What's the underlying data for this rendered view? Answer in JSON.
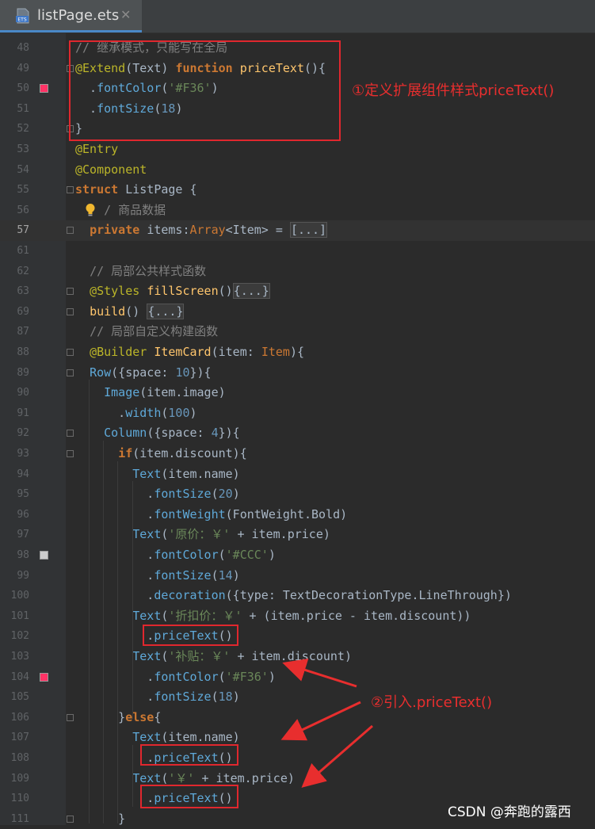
{
  "tab": {
    "title": "listPage.ets",
    "icon": "ets-file-icon",
    "close_glyph": "✕"
  },
  "lines": [
    {
      "n": "48",
      "tokens": [
        [
          "cmt",
          "// 继承模式，只能写在全局"
        ]
      ]
    },
    {
      "n": "49",
      "tokens": [
        [
          "dec",
          "@Extend"
        ],
        [
          "plain",
          "(Text) "
        ],
        [
          "kw",
          "function "
        ],
        [
          "fn",
          "priceText"
        ],
        [
          "plain",
          "(){"
        ]
      ]
    },
    {
      "n": "50",
      "swatch": "#F36",
      "tokens": [
        [
          "plain",
          "  ."
        ],
        [
          "meth",
          "fontColor"
        ],
        [
          "plain",
          "("
        ],
        [
          "str",
          "'#F36'"
        ],
        [
          "plain",
          ")"
        ]
      ]
    },
    {
      "n": "51",
      "tokens": [
        [
          "plain",
          "  ."
        ],
        [
          "meth",
          "fontSize"
        ],
        [
          "plain",
          "("
        ],
        [
          "num",
          "18"
        ],
        [
          "plain",
          ")"
        ]
      ]
    },
    {
      "n": "52",
      "tokens": [
        [
          "plain",
          "}"
        ]
      ]
    },
    {
      "n": "53",
      "tokens": [
        [
          "dec",
          "@Entry"
        ]
      ]
    },
    {
      "n": "54",
      "tokens": [
        [
          "dec",
          "@Component"
        ]
      ]
    },
    {
      "n": "55",
      "tokens": [
        [
          "kw",
          "struct "
        ],
        [
          "plain",
          "ListPage {"
        ]
      ]
    },
    {
      "n": "56",
      "tokens": [
        [
          "plain",
          "  "
        ],
        [
          "cmt",
          "  / 商品数据"
        ]
      ]
    },
    {
      "n": "57",
      "current": true,
      "tokens": [
        [
          "plain",
          "  "
        ],
        [
          "kw",
          "private "
        ],
        [
          "plain",
          "items:"
        ],
        [
          "ty",
          "Array"
        ],
        [
          "plain",
          "<Item> = "
        ],
        [
          "box",
          "[...]"
        ]
      ]
    },
    {
      "n": "61",
      "tokens": []
    },
    {
      "n": "62",
      "tokens": [
        [
          "plain",
          "  "
        ],
        [
          "cmt",
          "// 局部公共样式函数"
        ]
      ]
    },
    {
      "n": "63",
      "tokens": [
        [
          "plain",
          "  "
        ],
        [
          "dec",
          "@Styles "
        ],
        [
          "fn",
          "fillScreen"
        ],
        [
          "plain",
          "()"
        ],
        [
          "box",
          "{...}"
        ]
      ]
    },
    {
      "n": "69",
      "tokens": [
        [
          "plain",
          "  "
        ],
        [
          "fn",
          "build"
        ],
        [
          "plain",
          "() "
        ],
        [
          "box",
          "{...}"
        ]
      ]
    },
    {
      "n": "87",
      "tokens": [
        [
          "plain",
          "  "
        ],
        [
          "cmt",
          "// 局部自定义构建函数"
        ]
      ]
    },
    {
      "n": "88",
      "tokens": [
        [
          "plain",
          "  "
        ],
        [
          "dec",
          "@Builder "
        ],
        [
          "fn",
          "ItemCard"
        ],
        [
          "plain",
          "(item: "
        ],
        [
          "ty",
          "Item"
        ],
        [
          "plain",
          "){"
        ]
      ]
    },
    {
      "n": "89",
      "tokens": [
        [
          "plain",
          "  "
        ],
        [
          "comp",
          "Row"
        ],
        [
          "plain",
          "({space: "
        ],
        [
          "num",
          "10"
        ],
        [
          "plain",
          "}){"
        ]
      ]
    },
    {
      "n": "90",
      "tokens": [
        [
          "plain",
          "    "
        ],
        [
          "comp",
          "Image"
        ],
        [
          "plain",
          "(item.image)"
        ]
      ]
    },
    {
      "n": "91",
      "tokens": [
        [
          "plain",
          "      ."
        ],
        [
          "meth",
          "width"
        ],
        [
          "plain",
          "("
        ],
        [
          "num",
          "100"
        ],
        [
          "plain",
          ")"
        ]
      ]
    },
    {
      "n": "92",
      "tokens": [
        [
          "plain",
          "    "
        ],
        [
          "comp",
          "Column"
        ],
        [
          "plain",
          "({space: "
        ],
        [
          "num",
          "4"
        ],
        [
          "plain",
          "}){"
        ]
      ]
    },
    {
      "n": "93",
      "tokens": [
        [
          "plain",
          "      "
        ],
        [
          "kw",
          "if"
        ],
        [
          "plain",
          "(item.discount){"
        ]
      ]
    },
    {
      "n": "94",
      "tokens": [
        [
          "plain",
          "        "
        ],
        [
          "comp",
          "Text"
        ],
        [
          "plain",
          "(item.name)"
        ]
      ]
    },
    {
      "n": "95",
      "tokens": [
        [
          "plain",
          "          ."
        ],
        [
          "meth",
          "fontSize"
        ],
        [
          "plain",
          "("
        ],
        [
          "num",
          "20"
        ],
        [
          "plain",
          ")"
        ]
      ]
    },
    {
      "n": "96",
      "tokens": [
        [
          "plain",
          "          ."
        ],
        [
          "meth",
          "fontWeight"
        ],
        [
          "plain",
          "(FontWeight.Bold)"
        ]
      ]
    },
    {
      "n": "97",
      "tokens": [
        [
          "plain",
          "        "
        ],
        [
          "comp",
          "Text"
        ],
        [
          "plain",
          "("
        ],
        [
          "str",
          "'原价：￥'"
        ],
        [
          "plain",
          " + item.price)"
        ]
      ]
    },
    {
      "n": "98",
      "swatch": "#CCC",
      "tokens": [
        [
          "plain",
          "          ."
        ],
        [
          "meth",
          "fontColor"
        ],
        [
          "plain",
          "("
        ],
        [
          "str",
          "'#CCC'"
        ],
        [
          "plain",
          ")"
        ]
      ]
    },
    {
      "n": "99",
      "tokens": [
        [
          "plain",
          "          ."
        ],
        [
          "meth",
          "fontSize"
        ],
        [
          "plain",
          "("
        ],
        [
          "num",
          "14"
        ],
        [
          "plain",
          ")"
        ]
      ]
    },
    {
      "n": "100",
      "tokens": [
        [
          "plain",
          "          ."
        ],
        [
          "meth",
          "decoration"
        ],
        [
          "plain",
          "({type: TextDecorationType.LineThrough})"
        ]
      ]
    },
    {
      "n": "101",
      "tokens": [
        [
          "plain",
          "        "
        ],
        [
          "comp",
          "Text"
        ],
        [
          "plain",
          "("
        ],
        [
          "str",
          "'折扣价：￥'"
        ],
        [
          "plain",
          " + (item.price - item.discount))"
        ]
      ]
    },
    {
      "n": "102",
      "tokens": [
        [
          "plain",
          "          ."
        ],
        [
          "meth",
          "priceText"
        ],
        [
          "plain",
          "()"
        ]
      ]
    },
    {
      "n": "103",
      "tokens": [
        [
          "plain",
          "        "
        ],
        [
          "comp",
          "Text"
        ],
        [
          "plain",
          "("
        ],
        [
          "str",
          "'补贴：￥'"
        ],
        [
          "plain",
          " + item.discount)"
        ]
      ]
    },
    {
      "n": "104",
      "swatch": "#F36",
      "tokens": [
        [
          "plain",
          "          ."
        ],
        [
          "meth",
          "fontColor"
        ],
        [
          "plain",
          "("
        ],
        [
          "str",
          "'#F36'"
        ],
        [
          "plain",
          ")"
        ]
      ]
    },
    {
      "n": "105",
      "tokens": [
        [
          "plain",
          "          ."
        ],
        [
          "meth",
          "fontSize"
        ],
        [
          "plain",
          "("
        ],
        [
          "num",
          "18"
        ],
        [
          "plain",
          ")"
        ]
      ]
    },
    {
      "n": "106",
      "tokens": [
        [
          "plain",
          "      }"
        ],
        [
          "kw",
          "else"
        ],
        [
          "plain",
          "{"
        ]
      ]
    },
    {
      "n": "107",
      "tokens": [
        [
          "plain",
          "        "
        ],
        [
          "comp",
          "Text"
        ],
        [
          "plain",
          "(item.name)"
        ]
      ]
    },
    {
      "n": "108",
      "tokens": [
        [
          "plain",
          "          ."
        ],
        [
          "meth",
          "priceText"
        ],
        [
          "plain",
          "()"
        ]
      ]
    },
    {
      "n": "109",
      "tokens": [
        [
          "plain",
          "        "
        ],
        [
          "comp",
          "Text"
        ],
        [
          "plain",
          "("
        ],
        [
          "str",
          "'￥'"
        ],
        [
          "plain",
          " + item.price)"
        ]
      ]
    },
    {
      "n": "110",
      "tokens": [
        [
          "plain",
          "          ."
        ],
        [
          "meth",
          "priceText"
        ],
        [
          "plain",
          "()"
        ]
      ]
    },
    {
      "n": "111",
      "tokens": [
        [
          "plain",
          "      }"
        ]
      ]
    }
  ],
  "annotations": {
    "label1": "①定义扩展组件样式priceText()",
    "label2": "②引入.priceText()"
  },
  "watermark": "CSDN @奔跑的露西",
  "colors": {
    "annotation_red": "#e0272e",
    "tab_accent": "#4a88c7"
  }
}
